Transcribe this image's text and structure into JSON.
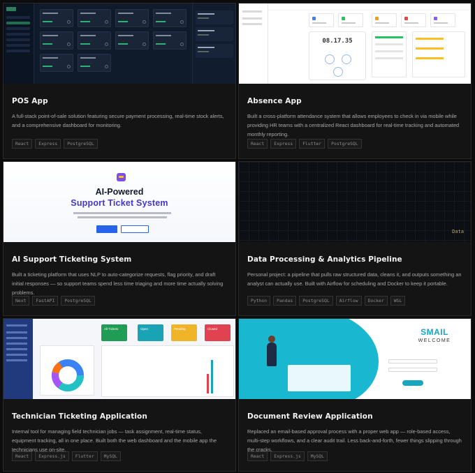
{
  "cards": [
    {
      "title": "POS App",
      "description": "A full-stack point-of-sale solution featuring secure payment processing, real-time stock alerts, and a comprehensive dashboard for monitoring.",
      "tags": [
        "React",
        "Express",
        "PostgreSQL"
      ]
    },
    {
      "title": "Absence App",
      "description": "Built a cross-platform attendance system that allows employees to check in via mobile while providing HR teams with a centralized React dashboard for real-time tracking and automated monthly reporting.",
      "tags": [
        "React",
        "Express",
        "Flutter",
        "PostgreSQL"
      ],
      "thumb_clock": "08.17.35"
    },
    {
      "title": "AI Support Ticketing System",
      "description": "Built a ticketing platform that uses NLP to auto-categorize requests, flag priority, and draft initial responses — so support teams spend less time triaging and more time actually solving problems.",
      "tags": [
        "Next",
        "FastAPI",
        "PostgreSQL"
      ],
      "thumb_heading_1": "AI-Powered",
      "thumb_heading_2": "Support Ticket System"
    },
    {
      "title": "Data Processing & Analytics Pipeline",
      "description": "Personal project: a pipeline that pulls raw structured data, cleans it, and outputs something an analyst can actually use. Built with Airflow for scheduling and Docker to keep it portable.",
      "tags": [
        "Python",
        "Pandas",
        "PostgreSQL",
        "Airflow",
        "Docker",
        "WSL"
      ],
      "thumb_label": "Data"
    },
    {
      "title": "Technician Ticketing Application",
      "description": "Internal tool for managing field technician jobs — task assignment, real-time status, equipment tracking, all in one place. Built both the web dashboard and the mobile app the technicians use on-site.",
      "tags": [
        "React",
        "Express.js",
        "Flutter",
        "MySQL"
      ],
      "thumb_kpis": [
        "All Tickets",
        "Open",
        "Pending",
        "Closed"
      ]
    },
    {
      "title": "Document Review Application",
      "description": "Replaced an email-based approval process with a proper web app — role-based access, multi-step workflows, and a clear audit trail. Less back-and-forth, fewer things slipping through the cracks.",
      "tags": [
        "React",
        "Express.js",
        "MySQL"
      ],
      "thumb_brand": "SMAIL",
      "thumb_welcome": "WELCOME"
    }
  ],
  "colors": {
    "page_bg": "#0c0c0c",
    "card_bg": "#141414",
    "card_border": "#2a2a2a",
    "title": "#f2f2f2",
    "body_text": "#a8a8a8",
    "tag_text": "#8a8a8a",
    "accent_indigo": "#4338ca",
    "accent_teal": "#19a7c0"
  }
}
